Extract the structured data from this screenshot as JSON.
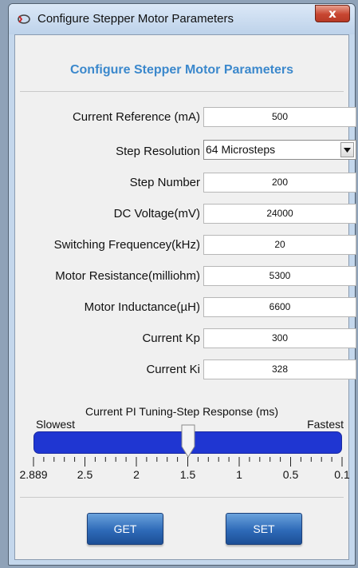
{
  "window": {
    "title": "Configure Stepper Motor Parameters",
    "close_label": "x",
    "icon": "stepper-motor-app-icon"
  },
  "panel": {
    "heading": "Configure Stepper Motor  Parameters",
    "heading_color": "#3b88cc"
  },
  "params": [
    {
      "label": "Current Reference (mA)",
      "value": "500"
    },
    {
      "label": "Step Resolution",
      "value": "64 Microsteps",
      "type": "dropdown"
    },
    {
      "label": "Step Number",
      "value": "200"
    },
    {
      "label": "DC Voltage(mV)",
      "value": "24000"
    },
    {
      "label": "Switching Frequencey(kHz)",
      "value": "20"
    },
    {
      "label": "Motor Resistance(milliohm)",
      "value": "5300"
    },
    {
      "label": "Motor Inductance(µH)",
      "value": "6600"
    },
    {
      "label": "Current Kp",
      "value": "300"
    },
    {
      "label": "Current Ki",
      "value": "328"
    }
  ],
  "slider": {
    "caption": "Current PI Tuning-Step Response (ms)",
    "left_label": "Slowest",
    "right_label": "Fastest",
    "tick_labels": [
      "2.889",
      "2.5",
      "2",
      "1.5",
      "1",
      "0.5",
      "0.1"
    ],
    "value": 1.5,
    "track_color": "#1f36d2"
  },
  "buttons": {
    "get_label": "GET",
    "set_label": "SET"
  }
}
